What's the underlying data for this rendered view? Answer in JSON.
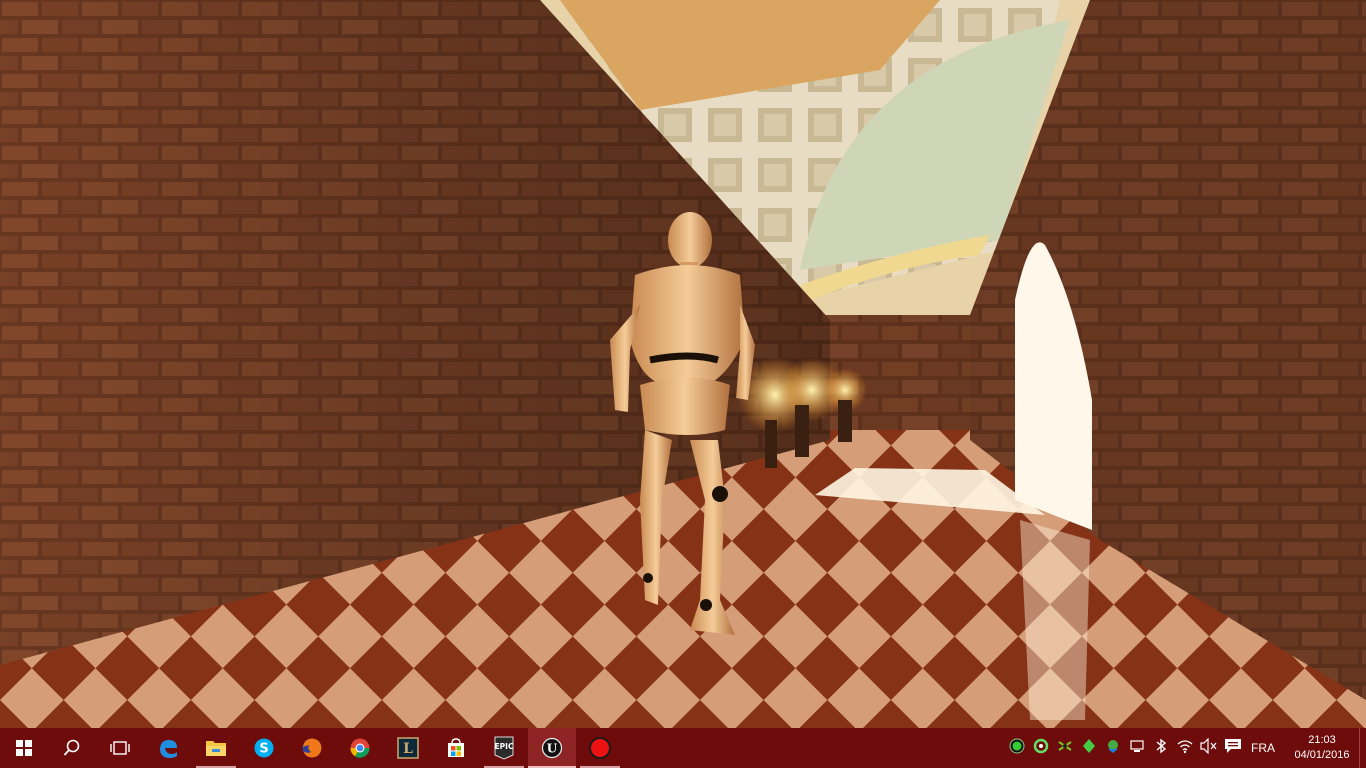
{
  "taskbar": {
    "start_icon": "windows-logo-icon",
    "search_icon": "search-icon",
    "taskview_icon": "task-view-icon",
    "apps": [
      {
        "name": "edge-icon"
      },
      {
        "name": "file-explorer-icon"
      },
      {
        "name": "skype-icon"
      },
      {
        "name": "firefox-icon"
      },
      {
        "name": "chrome-icon"
      },
      {
        "name": "league-of-legends-icon",
        "label": "L"
      },
      {
        "name": "store-icon"
      },
      {
        "name": "epic-games-launcher-icon",
        "label": "EPIC"
      },
      {
        "name": "unreal-engine-icon",
        "label": "U"
      },
      {
        "name": "record-icon"
      }
    ],
    "tray": {
      "language": "FRA",
      "time": "21:03",
      "date": "04/01/2016",
      "icons": [
        "green-circle-icon",
        "refresh-icon",
        "nvidia-icon",
        "razer-icon",
        "network-share-icon",
        "device-icon",
        "bluetooth-icon",
        "wifi-icon",
        "volume-muted-icon",
        "action-center-icon"
      ]
    }
  },
  "colors": {
    "taskbar": "#6e0b0b",
    "brick": "#7a4024",
    "floor_light": "#e8b48a",
    "floor_dark": "#8a3418"
  }
}
